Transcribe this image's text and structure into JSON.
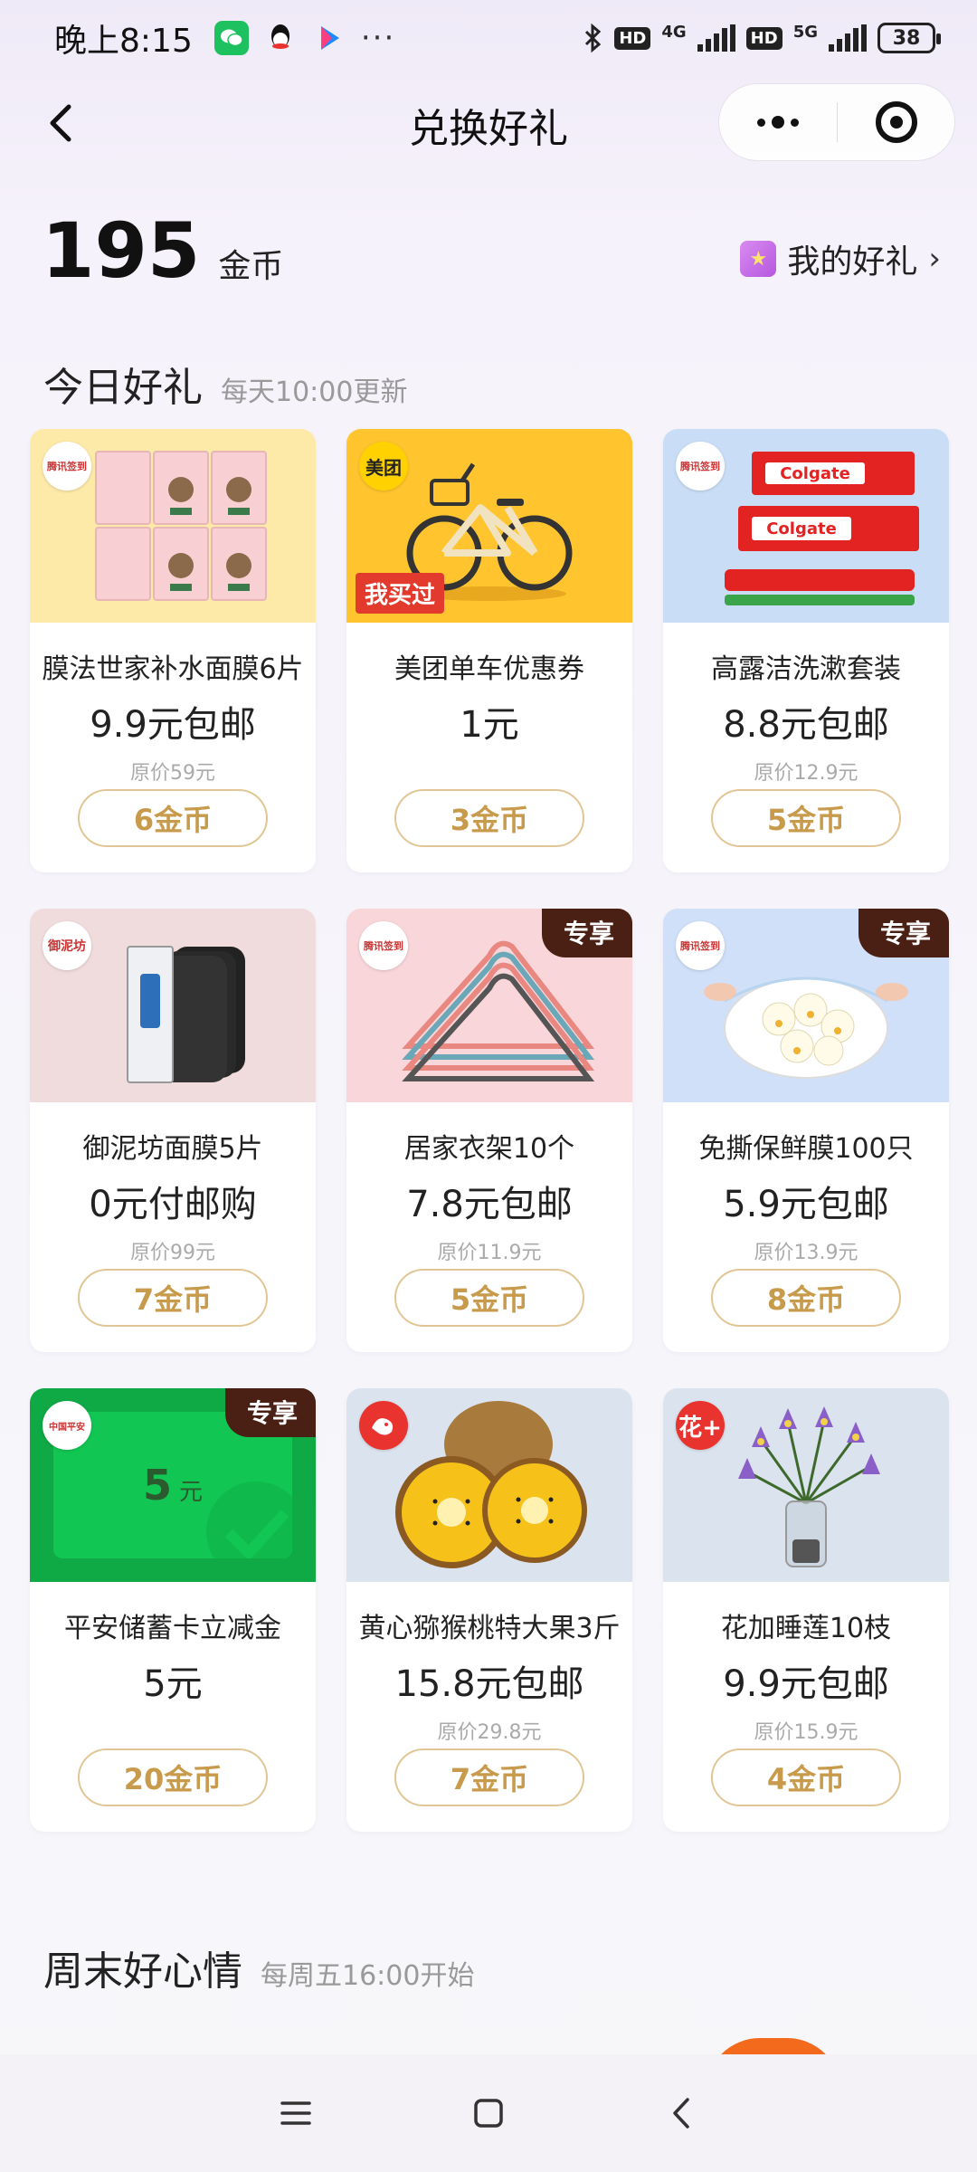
{
  "status_bar": {
    "time": "晚上8:15",
    "more": "···",
    "hd1": "HD",
    "net1": "4G",
    "hd2": "HD",
    "net2": "5G",
    "battery": "38"
  },
  "nav": {
    "title": "兑换好礼"
  },
  "coins": {
    "amount": "195",
    "unit": "金币",
    "my_gifts_label": "我的好礼"
  },
  "today": {
    "title": "今日好礼",
    "subtitle": "每天10:00更新",
    "items": [
      {
        "name": "膜法世家补水面膜6片",
        "price": "9.9元包邮",
        "orig": "原价59元",
        "coins": "6金币",
        "badge": "腾讯签到",
        "tag": ""
      },
      {
        "name": "美团单车优惠券",
        "price": "1元",
        "orig": "",
        "coins": "3金币",
        "badge": "美团",
        "tag": "我买过"
      },
      {
        "name": "高露洁洗漱套装",
        "price": "8.8元包邮",
        "orig": "原价12.9元",
        "coins": "5金币",
        "badge": "腾讯签到",
        "tag": ""
      },
      {
        "name": "御泥坊面膜5片",
        "price": "0元付邮购",
        "orig": "原价99元",
        "coins": "7金币",
        "badge": "御泥坊",
        "tag": ""
      },
      {
        "name": "居家衣架10个",
        "price": "7.8元包邮",
        "orig": "原价11.9元",
        "coins": "5金币",
        "badge": "腾讯签到",
        "tag": "专享"
      },
      {
        "name": "免撕保鲜膜100只",
        "price": "5.9元包邮",
        "orig": "原价13.9元",
        "coins": "8金币",
        "badge": "腾讯签到",
        "tag": "专享"
      },
      {
        "name": "平安储蓄卡立减金",
        "price": "5元",
        "orig": "",
        "coins": "20金币",
        "badge": "中国平安",
        "tag": "专享",
        "voucher_amount": "5",
        "voucher_unit": "元"
      },
      {
        "name": "黄心猕猴桃特大果3斤",
        "price": "15.8元包邮",
        "orig": "原价29.8元",
        "coins": "7金币",
        "badge": "",
        "tag": ""
      },
      {
        "name": "花加睡莲10枝",
        "price": "9.9元包邮",
        "orig": "原价15.9元",
        "coins": "4金币",
        "badge": "花+",
        "tag": ""
      }
    ]
  },
  "weekend": {
    "title": "周末好心情",
    "subtitle": "每周五16:00开始"
  },
  "colors": {
    "coin_gold": "#c89a4c",
    "vip_tag": "#4a1f14",
    "accent_red": "#e23b2e"
  }
}
